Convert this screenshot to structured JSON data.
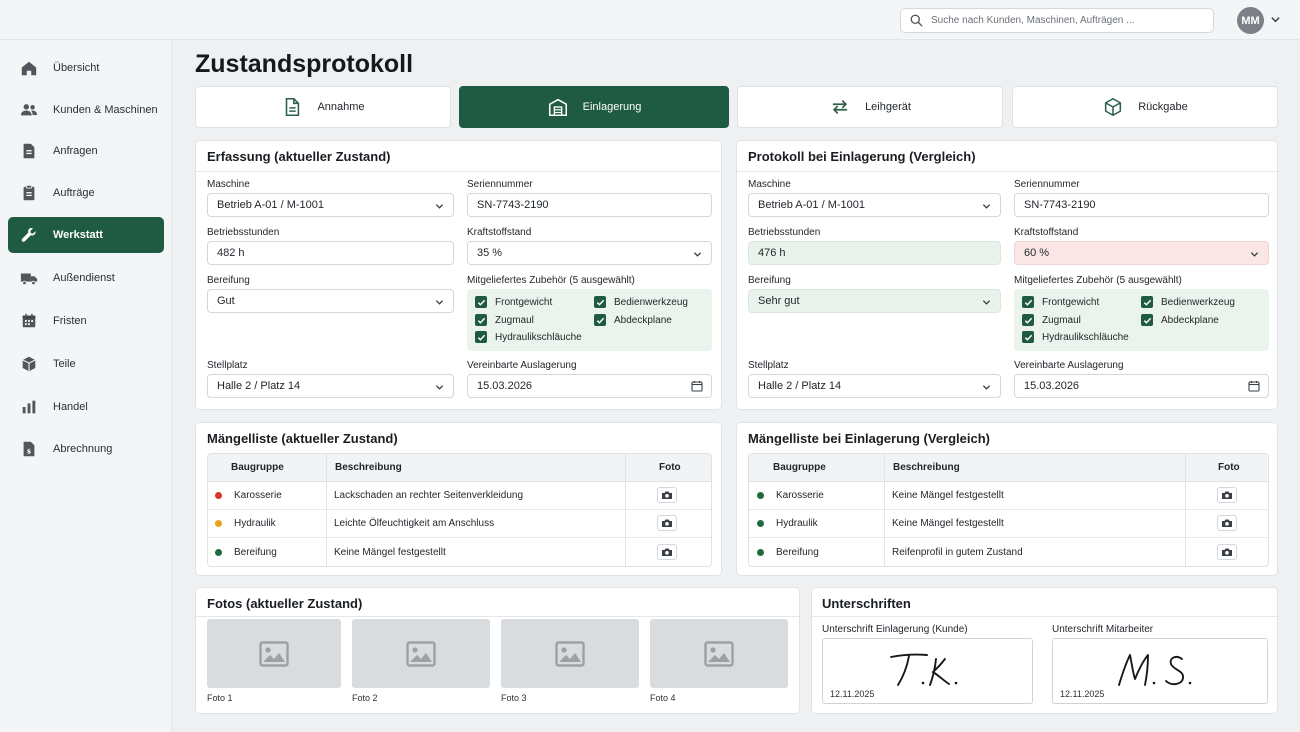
{
  "header": {
    "search_placeholder": "Suche nach Kunden, Maschinen, Aufträgen ...",
    "avatar_initials": "MM"
  },
  "sidebar": {
    "items": [
      {
        "label": "Übersicht",
        "icon": "home-icon"
      },
      {
        "label": "Kunden & Maschinen",
        "icon": "users-icon"
      },
      {
        "label": "Anfragen",
        "icon": "document-icon"
      },
      {
        "label": "Aufträge",
        "icon": "clipboard-icon"
      },
      {
        "label": "Werkstatt",
        "icon": "wrench-icon",
        "active": true
      },
      {
        "label": "Außendienst",
        "icon": "truck-icon"
      },
      {
        "label": "Fristen",
        "icon": "calendar-icon"
      },
      {
        "label": "Teile",
        "icon": "box-icon"
      },
      {
        "label": "Handel",
        "icon": "bar-chart-icon"
      },
      {
        "label": "Abrechnung",
        "icon": "invoice-icon"
      }
    ]
  },
  "page": {
    "title": "Zustandsprotokoll"
  },
  "tabs": [
    {
      "label": "Annahme",
      "icon": "document-icon"
    },
    {
      "label": "Einlagerung",
      "icon": "warehouse-icon",
      "active": true
    },
    {
      "label": "Leihgerät",
      "icon": "swap-icon"
    },
    {
      "label": "Rückgabe",
      "icon": "package-icon"
    }
  ],
  "current": {
    "title": "Erfassung (aktueller Zustand)",
    "labels": {
      "maschine": "Maschine",
      "seriennummer": "Seriennummer",
      "betriebsstunden": "Betriebsstunden",
      "kraftstoff": "Kraftstoffstand",
      "bereifung": "Bereifung",
      "zubehoer": "Mitgeliefertes Zubehör (5 ausgewählt)",
      "stellplatz": "Stellplatz",
      "auslagerung": "Vereinbarte Auslagerung"
    },
    "values": {
      "maschine": "Betrieb A-01 / M-1001",
      "seriennummer": "SN-7743-2190",
      "betriebsstunden": "482 h",
      "kraftstoff": "35 %",
      "bereifung": "Gut",
      "stellplatz": "Halle 2 / Platz 14",
      "auslagerung": "15.03.2026"
    },
    "accessories": [
      "Frontgewicht",
      "Bedienwerkzeug",
      "Zugmaul",
      "Abdeckplane",
      "Hydraulikschläuche"
    ]
  },
  "compare": {
    "title": "Protokoll bei Einlagerung (Vergleich)",
    "labels": {
      "maschine": "Maschine",
      "seriennummer": "Seriennummer",
      "betriebsstunden": "Betriebsstunden",
      "kraftstoff": "Kraftstoffstand",
      "bereifung": "Bereifung",
      "zubehoer": "Mitgeliefertes Zubehör (5 ausgewählt)",
      "stellplatz": "Stellplatz",
      "auslagerung": "Vereinbarte Auslagerung"
    },
    "values": {
      "maschine": "Betrieb A-01 / M-1001",
      "seriennummer": "SN-7743-2190",
      "betriebsstunden": "476 h",
      "kraftstoff": "60 %",
      "bereifung": "Sehr gut",
      "stellplatz": "Halle 2 / Platz 14",
      "auslagerung": "15.03.2026"
    },
    "accessories": [
      "Frontgewicht",
      "Bedienwerkzeug",
      "Zugmaul",
      "Abdeckplane",
      "Hydraulikschläuche"
    ]
  },
  "defects_current": {
    "title": "Mängelliste (aktueller Zustand)",
    "columns": [
      "Baugruppe",
      "Beschreibung",
      "Foto"
    ],
    "rows": [
      {
        "group": "Karosserie",
        "desc": "Lackschaden an rechter Seitenverkleidung",
        "status_color": "#d9342b"
      },
      {
        "group": "Hydraulik",
        "desc": "Leichte Ölfeuchtigkeit am Anschluss",
        "status_color": "#e8a317"
      },
      {
        "group": "Bereifung",
        "desc": "Keine Mängel festgestellt",
        "status_color": "#1f6b3f"
      }
    ]
  },
  "defects_compare": {
    "title": "Mängelliste bei Einlagerung (Vergleich)",
    "columns": [
      "Baugruppe",
      "Beschreibung",
      "Foto"
    ],
    "rows": [
      {
        "group": "Karosserie",
        "desc": "Keine Mängel festgestellt",
        "status_color": "#1f6b3f"
      },
      {
        "group": "Hydraulik",
        "desc": "Keine Mängel festgestellt",
        "status_color": "#1f6b3f"
      },
      {
        "group": "Bereifung",
        "desc": "Reifenprofil in gutem Zustand",
        "status_color": "#1f6b3f"
      }
    ]
  },
  "photos": {
    "title": "Fotos (aktueller Zustand)",
    "items": [
      "Foto 1",
      "Foto 2",
      "Foto 3",
      "Foto 4"
    ]
  },
  "signatures": {
    "title": "Unterschriften",
    "customer": {
      "label": "Unterschrift Einlagerung (Kunde)",
      "signature": "T. K.",
      "date": "12.11.2025"
    },
    "employee": {
      "label": "Unterschrift Mitarbeiter",
      "signature": "M. S.",
      "date": "12.11.2025"
    }
  },
  "colors": {
    "accent": "#1f5a43",
    "accent_light": "#ebf3ed",
    "warning_bg": "#fbe6e6"
  }
}
